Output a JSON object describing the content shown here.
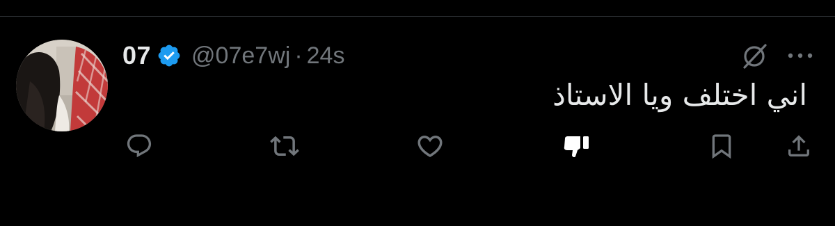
{
  "author": {
    "display_name": "07",
    "handle": "@07e7wj",
    "separator": "·",
    "timestamp": "24s",
    "verified": true
  },
  "tweet": {
    "text": "اني اختلف ويا الاستاذ"
  },
  "icons": {
    "verified": "verified-badge-icon",
    "grok": "grok-icon",
    "more": "more-icon",
    "reply": "reply-icon",
    "retweet": "retweet-icon",
    "like": "like-icon",
    "dislike": "thumbs-down-icon",
    "bookmark": "bookmark-icon",
    "share": "share-icon"
  },
  "colors": {
    "background": "#000000",
    "text_primary": "#e7e9ea",
    "text_secondary": "#71767b",
    "verified_blue": "#1d9bf0",
    "divider": "#2f3336"
  }
}
